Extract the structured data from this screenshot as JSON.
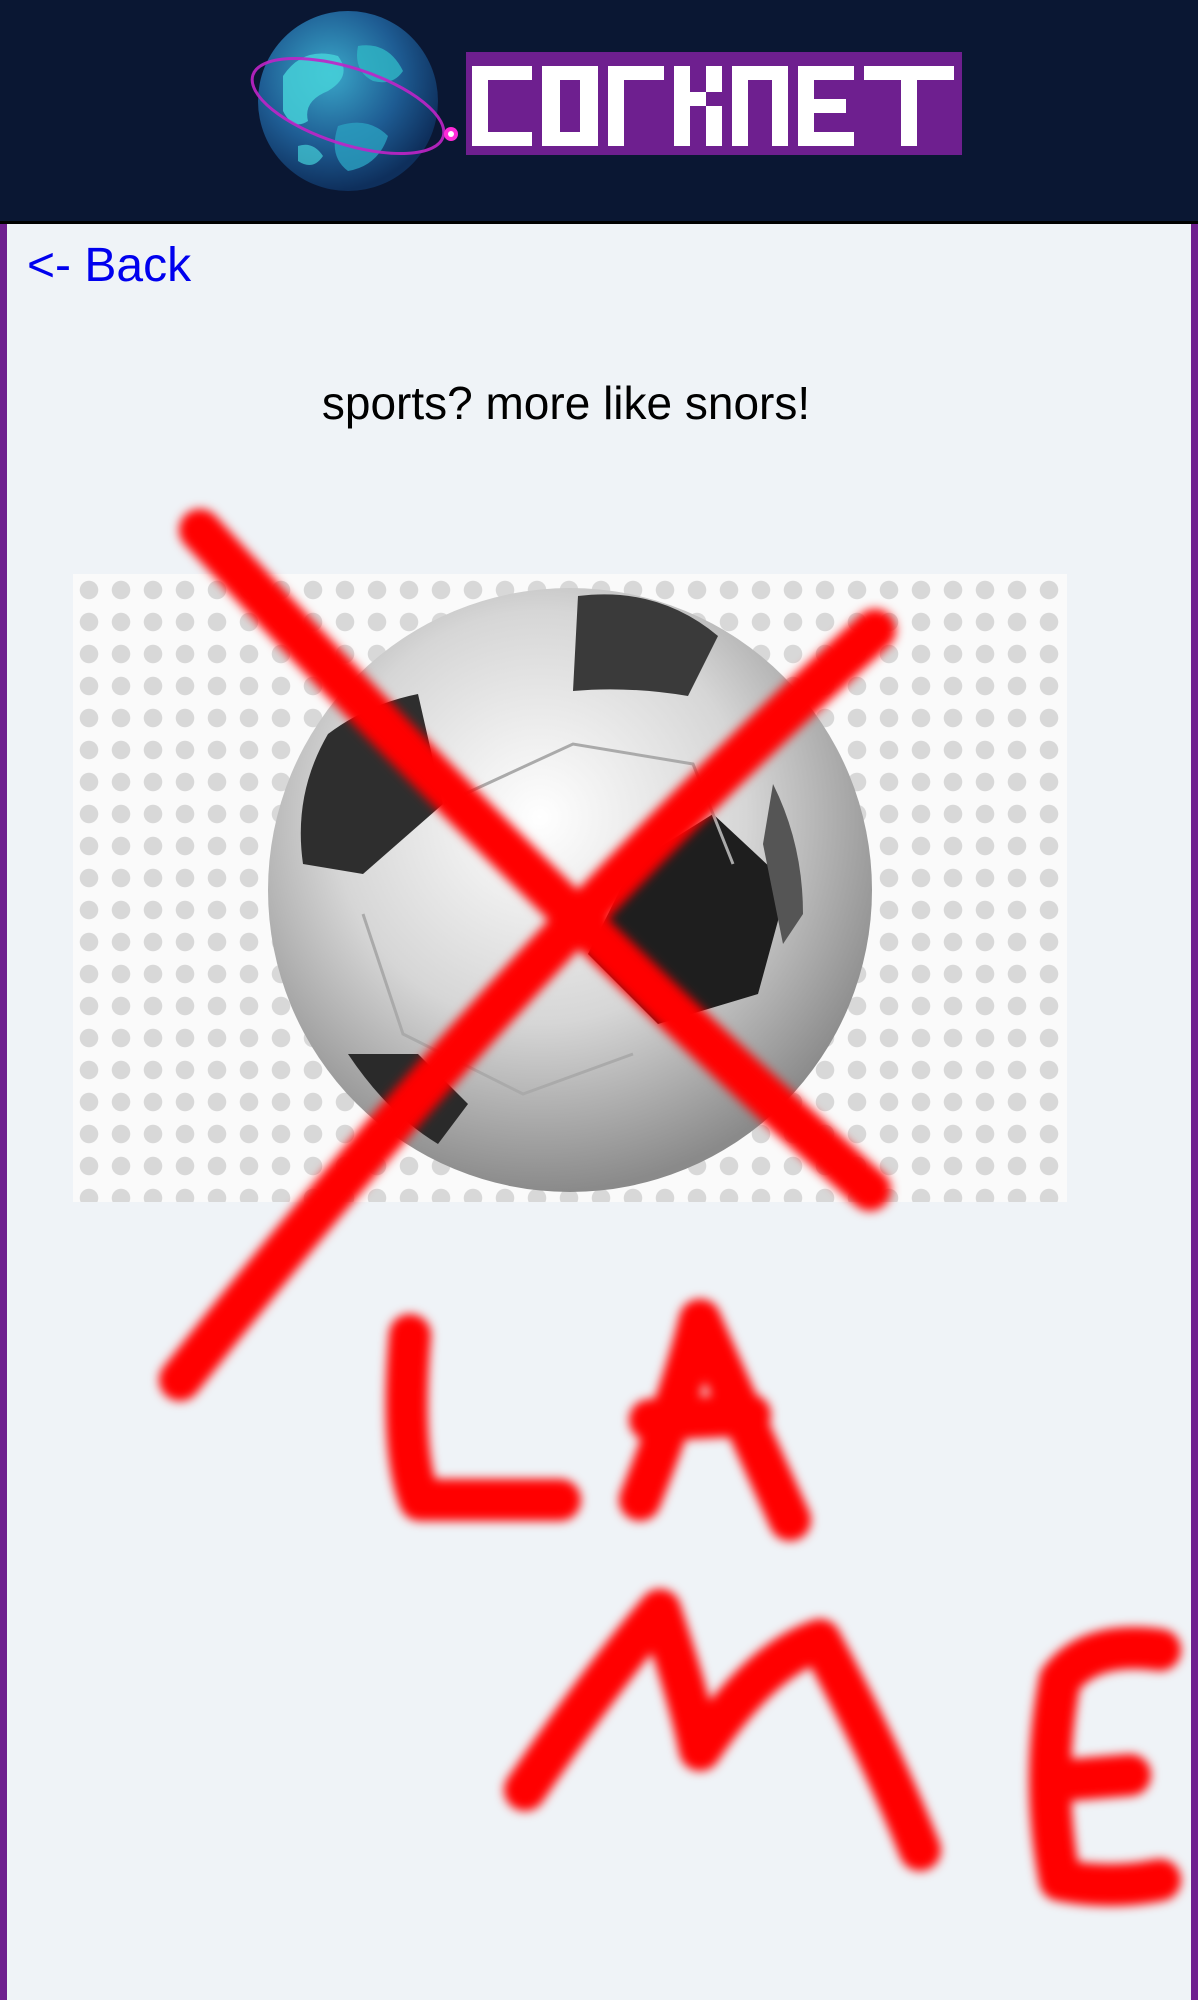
{
  "header": {
    "logo_text": "CORKNET",
    "logo_color": "#6e1f8f",
    "background_color": "#0a1733"
  },
  "nav": {
    "back_label": "<- Back"
  },
  "post": {
    "headline": "sports? more like snors!",
    "image_subject": "soccer-ball",
    "overlay_text": "LAME",
    "overlay_color": "#ff0000"
  }
}
